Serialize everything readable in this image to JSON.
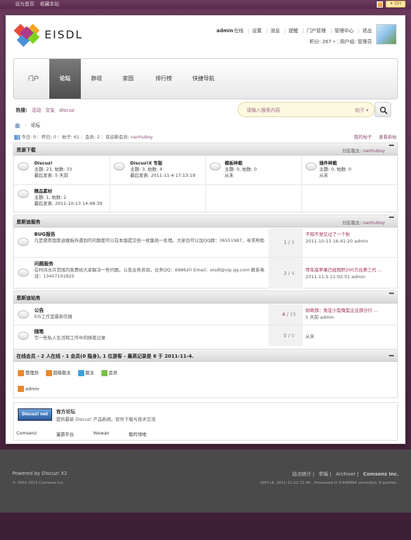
{
  "topbar": {
    "links": [
      "设为首页",
      "收藏本站"
    ],
    "diy": "DIY"
  },
  "brand": {
    "name": "EISDL"
  },
  "user": {
    "name": "admin",
    "status": "在线",
    "links": [
      "设置",
      "消息",
      "提醒",
      "门户管理",
      "管理中心",
      "退出"
    ],
    "points": "积分: 267",
    "group": "用户组: 管理员"
  },
  "nav": [
    "门户",
    "论坛",
    "群组",
    "家园",
    "排行榜",
    "快捷导航"
  ],
  "hot": {
    "label": "热搜:",
    "items": [
      "活动",
      "交友",
      "discuz"
    ]
  },
  "search": {
    "placeholder": "请输入搜索内容",
    "scope": "帖子"
  },
  "breadcrumb": {
    "current": "论坛"
  },
  "stats": {
    "today": "今日: 0",
    "yesterday": "昨日: 0",
    "posts": "帖子: 61",
    "members": "会员: 2",
    "welcome": "欢迎新会员:",
    "newest": "nanhuboy",
    "my_posts": "我的帖子",
    "new_posts": "查看新帖"
  },
  "sec1": {
    "title": "资源下载",
    "mod_label": "分区版主:",
    "mod": "nanhuboy",
    "forums": [
      {
        "name": "Discuz!",
        "stats": "主题: 23, 帖数: 33",
        "last": "最后发表: 5 天前"
      },
      {
        "name": "Discuz!X 专版",
        "stats": "主题: 3, 帖数: 4",
        "last": "最后发表: 2011-11-4 17:13:19"
      },
      {
        "name": "模板碎截",
        "stats": "主题: 0, 帖数: 0",
        "last": "从未"
      },
      {
        "name": "插件碎截",
        "stats": "主题: 0, 帖数: 0",
        "last": "从未"
      },
      {
        "name": "精品素材",
        "stats": "主题: 1, 帖数: 2",
        "last": "最后发表: 2011-10-13 14:48:39"
      }
    ]
  },
  "sec2": {
    "title": "恩斯迪服务",
    "mod_label": "分区版主:",
    "mod": "nanhuboy",
    "forums": [
      {
        "name": "BUG报告",
        "desc": "凡是使用恩斯迪模板所遇到的问题都可以在本版提交统一收集统一处理。大家也可以加QQ群：36551987，寻求帮助",
        "topics": "1",
        "posts": "3",
        "last_title": "不知不觉又过了一个秋",
        "last_info": "2011-10-13 16:41:20 admin"
      },
      {
        "name": "问题服务",
        "desc": "在时间允许范围内免费给大家解决一些问题。以及业务咨询，业务QQ：698620 Email：eisdl@vip.qq.com 联系电话：13407191825",
        "topics": "3",
        "posts": "4",
        "last_title": "传年底苹果已经囤积200万台第三代 ...",
        "last_info": "2011-11-5 11:02:51 admin"
      }
    ]
  },
  "sec3": {
    "title": "恩斯迪站务",
    "forums": [
      {
        "name": "公告",
        "desc": "EIS工作室最新信报",
        "topics": "4",
        "posts": "15",
        "last_title": "财政部：免征小型微型企业部分行 ...",
        "last_info": "5 天前 admin"
      },
      {
        "name": "随笔",
        "desc": "写一些私人生活和工作中的随笔记录",
        "topics": "0",
        "posts": "0",
        "last_title": "",
        "last_info": "从未"
      }
    ]
  },
  "online": {
    "title": "在线会员 - 2 人在线 - 1 会员(0 隐身), 1 位游客 - 最高记录是 6 于 2011-11-4.",
    "legend": [
      "管理员",
      "超级版主",
      "版主",
      "会员"
    ],
    "legend_colors": [
      "#e8892e",
      "#e8892e",
      "#3aa0d8",
      "#7cc04a"
    ],
    "users": [
      "admin"
    ]
  },
  "friendlinks": {
    "badge": "Discuz! net",
    "title": "官方论坛",
    "desc": "提供最新 Discuz! 产品新闻、软件下载与技术交流",
    "links": [
      "Comsenz",
      "漫游平台",
      "Yeswan",
      "我的领地"
    ]
  },
  "footer": {
    "powered": "Powered by Discuz! X2",
    "copyright": "© 2001-2011 Comsenz Inc.",
    "links": [
      "站点统计",
      "举报",
      "Archiver",
      "Comsenz Inc."
    ],
    "debug": "GMT+8, 2011-11-22 11:46 , Processed in 0.696894 second(s), 9 queries ."
  }
}
